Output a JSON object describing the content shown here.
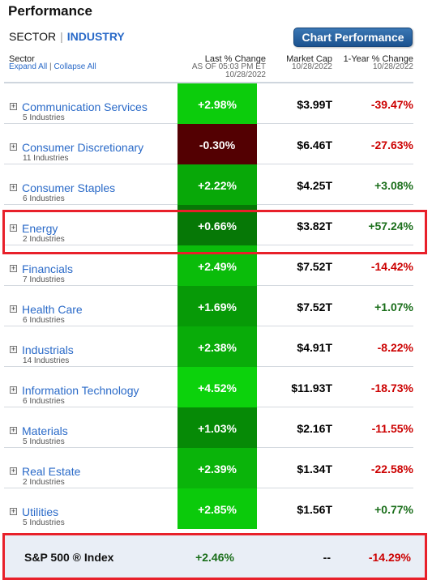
{
  "title": "Performance",
  "view_toggle": {
    "sector": "SECTOR",
    "separator": "|",
    "industry": "INDUSTRY"
  },
  "chart_button": "Chart Performance",
  "headers": {
    "sector": "Sector",
    "expand_all": "Expand All",
    "links_separator": "|",
    "collapse_all": "Collapse All",
    "last_change": "Last % Change",
    "last_change_asof": "AS OF 05:03 PM ET",
    "last_change_date": "10/28/2022",
    "market_cap": "Market Cap",
    "market_cap_date": "10/28/2022",
    "year_change": "1-Year % Change",
    "year_change_date": "10/28/2022"
  },
  "colors": {
    "link_blue": "#2a6ac8",
    "positive": "#1a6e1a",
    "negative": "#cc0000",
    "highlight_red": "#e8202a"
  },
  "sectors": [
    {
      "name": "Communication Services",
      "industries": "5 Industries",
      "last_change": "+2.98%",
      "cell_color": "#0ccc0c",
      "market_cap": "$3.99T",
      "year_change": "-39.47%",
      "year_dir": "neg"
    },
    {
      "name": "Consumer Discretionary",
      "industries": "11 Industries",
      "last_change": "-0.30%",
      "cell_color": "#530002",
      "market_cap": "$6.46T",
      "year_change": "-27.63%",
      "year_dir": "neg"
    },
    {
      "name": "Consumer Staples",
      "industries": "6 Industries",
      "last_change": "+2.22%",
      "cell_color": "#08a808",
      "market_cap": "$4.25T",
      "year_change": "+3.08%",
      "year_dir": "pos"
    },
    {
      "name": "Energy",
      "industries": "2 Industries",
      "last_change": "+0.66%",
      "cell_color": "#067806",
      "market_cap": "$3.82T",
      "year_change": "+57.24%",
      "year_dir": "pos"
    },
    {
      "name": "Financials",
      "industries": "7 Industries",
      "last_change": "+2.49%",
      "cell_color": "#0abc0a",
      "market_cap": "$7.52T",
      "year_change": "-14.42%",
      "year_dir": "neg"
    },
    {
      "name": "Health Care",
      "industries": "6 Industries",
      "last_change": "+1.69%",
      "cell_color": "#079a07",
      "market_cap": "$7.52T",
      "year_change": "+1.07%",
      "year_dir": "pos"
    },
    {
      "name": "Industrials",
      "industries": "14 Industries",
      "last_change": "+2.38%",
      "cell_color": "#09ac09",
      "market_cap": "$4.91T",
      "year_change": "-8.22%",
      "year_dir": "neg"
    },
    {
      "name": "Information Technology",
      "industries": "6 Industries",
      "last_change": "+4.52%",
      "cell_color": "#0cd20c",
      "market_cap": "$11.93T",
      "year_change": "-18.73%",
      "year_dir": "neg"
    },
    {
      "name": "Materials",
      "industries": "5 Industries",
      "last_change": "+1.03%",
      "cell_color": "#068a06",
      "market_cap": "$2.16T",
      "year_change": "-11.55%",
      "year_dir": "neg"
    },
    {
      "name": "Real Estate",
      "industries": "2 Industries",
      "last_change": "+2.39%",
      "cell_color": "#0ab40a",
      "market_cap": "$1.34T",
      "year_change": "-22.58%",
      "year_dir": "neg"
    },
    {
      "name": "Utilities",
      "industries": "5 Industries",
      "last_change": "+2.85%",
      "cell_color": "#0bca0b",
      "market_cap": "$1.56T",
      "year_change": "+0.77%",
      "year_dir": "pos"
    }
  ],
  "index_row": {
    "name": "S&P 500 ® Index",
    "last_change": "+2.46%",
    "last_dir": "pos",
    "market_cap": "--",
    "year_change": "-14.29%",
    "year_dir": "neg"
  }
}
